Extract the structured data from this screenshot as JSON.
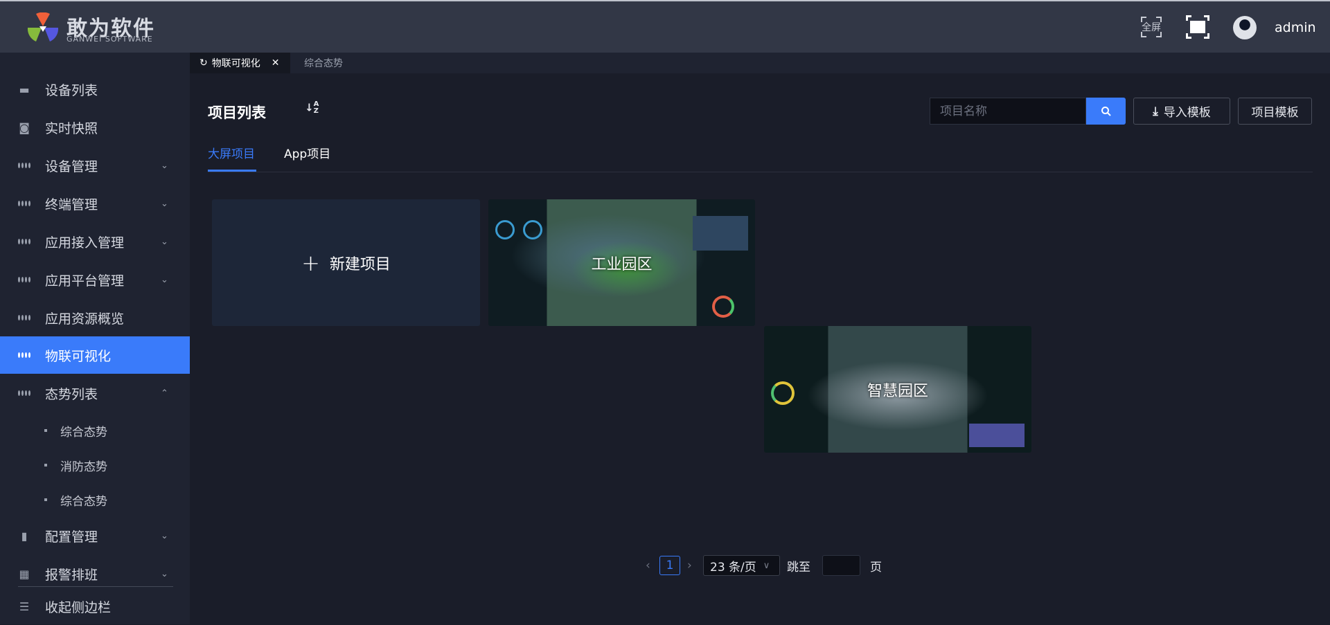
{
  "header": {
    "brand": "敢为软件",
    "brand_sub": "GANWEI SOFTWARE",
    "fullscreen_label": "全屏",
    "username": "admin"
  },
  "sidebar": {
    "items": [
      {
        "label": "设备列表",
        "icon": "monitor-icon"
      },
      {
        "label": "实时快照",
        "icon": "camera-icon"
      },
      {
        "label": "设备管理",
        "icon": "clover-icon",
        "chevron": "down"
      },
      {
        "label": "终端管理",
        "icon": "clover-icon",
        "chevron": "down"
      },
      {
        "label": "应用接入管理",
        "icon": "clover-icon",
        "chevron": "down"
      },
      {
        "label": "应用平台管理",
        "icon": "clover-icon",
        "chevron": "down"
      },
      {
        "label": "应用资源概览",
        "icon": "clover-icon"
      },
      {
        "label": "物联可视化",
        "icon": "clover-icon",
        "active": true
      },
      {
        "label": "态势列表",
        "icon": "clover-icon",
        "chevron": "up"
      }
    ],
    "sub_items": [
      "综合态势",
      "消防态势",
      "综合态势"
    ],
    "bottom_items": [
      {
        "label": "配置管理",
        "icon": "bookmark-icon"
      },
      {
        "label": "报警排班",
        "icon": "calendar-icon"
      }
    ],
    "collapse_label": "收起侧边栏"
  },
  "tabs": {
    "active": "物联可视化",
    "other": "综合态势"
  },
  "main": {
    "title": "项目列表",
    "sort_icon": "A Z",
    "search_placeholder": "项目名称",
    "import_label": "导入模板",
    "template_label": "项目模板",
    "project_tabs": [
      "大屏项目",
      "App项目"
    ],
    "new_project": "新建项目",
    "projects": [
      "工业园区",
      "智慧园区"
    ]
  },
  "pagination": {
    "current": "1",
    "page_size": "23 条/页",
    "jump_label": "跳至",
    "page_suffix": "页"
  },
  "colors": {
    "accent": "#3a7bfa"
  }
}
